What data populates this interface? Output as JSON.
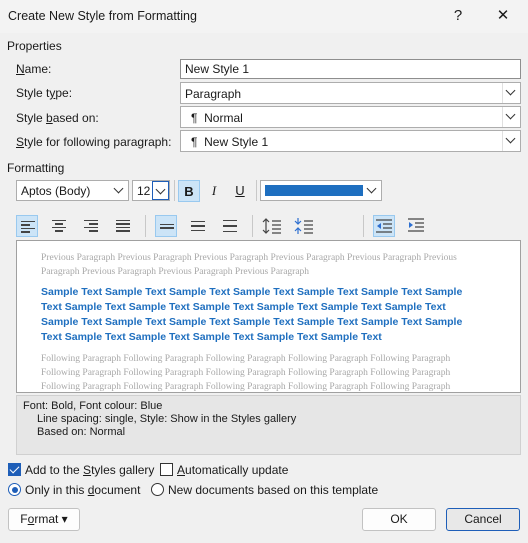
{
  "window": {
    "title": "Create New Style from Formatting",
    "help_glyph": "?",
    "close_glyph": "✕"
  },
  "properties": {
    "section_label": "Properties",
    "name_label_u": "N",
    "name_label_rest": "ame:",
    "name_value": "New Style 1",
    "type_label_pre": "Style t",
    "type_label_u": "y",
    "type_label_rest": "pe:",
    "type_value": "Paragraph",
    "based_label_pre": "Style ",
    "based_label_u": "b",
    "based_label_rest": "ased on:",
    "based_value": "Normal",
    "following_label_u": "S",
    "following_label_rest": "tyle for following paragraph:",
    "following_value": "New Style 1",
    "paragraph_glyph": "¶"
  },
  "formatting": {
    "section_label": "Formatting",
    "font_name": "Aptos (Body)",
    "font_size": "12",
    "bold_label": "B",
    "italic_label": "I",
    "underline_label": "U",
    "font_color": "#1e6fc0"
  },
  "preview": {
    "previous_text": "Previous Paragraph Previous Paragraph Previous Paragraph Previous Paragraph Previous Paragraph Previous Paragraph Previous Paragraph Previous Paragraph Previous Paragraph",
    "sample_text": "Sample Text Sample Text Sample Text Sample Text Sample Text Sample Text Sample Text Sample Text Sample Text Sample Text Sample Text Sample Text Sample Text Sample Text Sample Text Sample Text Sample Text Sample Text Sample Text Sample Text Sample Text Sample Text Sample Text Sample Text Sample Text",
    "following_text": "Following Paragraph Following Paragraph Following Paragraph Following Paragraph Following Paragraph Following Paragraph Following Paragraph Following Paragraph Following Paragraph Following Paragraph Following Paragraph Following Paragraph Following Paragraph Following Paragraph Following Paragraph"
  },
  "description": {
    "line1": "Font: Bold, Font colour: Blue",
    "line2": "Line spacing:  single, Style: Show in the Styles gallery",
    "line3": "Based on: Normal"
  },
  "options": {
    "add_to_gallery_pre": "Add to the ",
    "add_to_gallery_u": "S",
    "add_to_gallery_rest": "tyles gallery",
    "add_to_gallery_checked": true,
    "auto_update_u": "A",
    "auto_update_rest": "utomatically update",
    "auto_update_checked": false,
    "only_doc_pre": "Only in this ",
    "only_doc_u": "d",
    "only_doc_rest": "ocument",
    "new_docs_label": "New documents based on this template",
    "selected_scope": "only_in_this_document"
  },
  "buttons": {
    "format_u": "o",
    "format_pre": "F",
    "format_rest": "rmat",
    "format_arrow": "▾",
    "ok_label": "OK",
    "cancel_label": "Cancel"
  },
  "colors": {
    "accent": "#1e5eb8",
    "sample_text": "#1f6fbf"
  }
}
